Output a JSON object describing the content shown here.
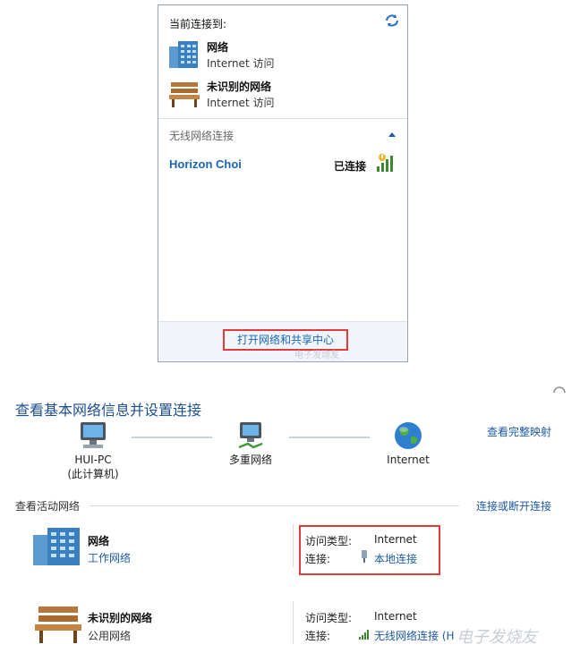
{
  "popup": {
    "header": "当前连接到:",
    "connections": [
      {
        "name": "网络",
        "status": "Internet 访问",
        "icon": "network-building-icon"
      },
      {
        "name": "未识别的网络",
        "status": "Internet 访问",
        "icon": "park-bench-icon"
      }
    ],
    "wireless_header": "无线网络连接",
    "wifi": {
      "name": "Horizon Choi",
      "status": "已连接"
    },
    "open_center_button": "打开网络和共享中心",
    "watermark": "电子发烧友"
  },
  "center": {
    "title": "查看基本网络信息并设置连接",
    "full_map_link": "查看完整映射",
    "map_nodes": [
      {
        "label": "HUI-PC",
        "sub": "(此计算机)"
      },
      {
        "label": "多重网络"
      },
      {
        "label": "Internet"
      }
    ],
    "active_header": "查看活动网络",
    "connect_link": "连接或断开连接",
    "networks": [
      {
        "name": "网络",
        "type": "工作网络",
        "access_label": "访问类型:",
        "access_value": "Internet",
        "conn_label": "连接:",
        "conn_value": "本地连接"
      },
      {
        "name": "未识别的网络",
        "type": "公用网络",
        "access_label": "访问类型:",
        "access_value": "Internet",
        "conn_label": "连接:",
        "conn_value": "无线网络连接 (H"
      }
    ],
    "watermark": "电子发烧友"
  },
  "colors": {
    "link": "#1e5aa8",
    "highlight": "#e03a3a",
    "title": "#1e4f90"
  }
}
